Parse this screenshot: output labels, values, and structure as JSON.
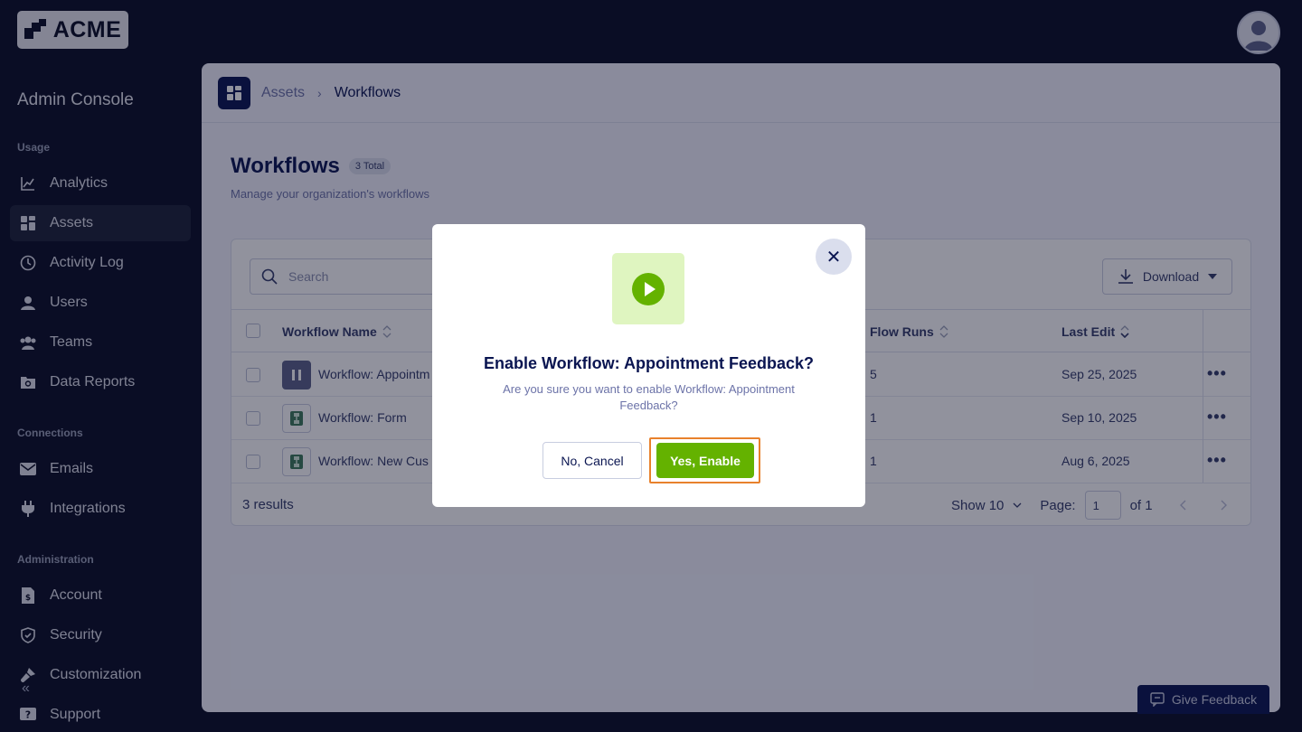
{
  "brand": {
    "logo_text": "ACME"
  },
  "sidebar": {
    "title": "Admin Console",
    "sections": {
      "usage": "Usage",
      "connections": "Connections",
      "administration": "Administration"
    },
    "items": [
      {
        "label": "Analytics",
        "icon": "chart-icon"
      },
      {
        "label": "Assets",
        "icon": "assets-icon",
        "active": true
      },
      {
        "label": "Activity Log",
        "icon": "clock-icon"
      },
      {
        "label": "Users",
        "icon": "user-icon"
      },
      {
        "label": "Teams",
        "icon": "team-icon"
      },
      {
        "label": "Data Reports",
        "icon": "report-icon"
      },
      {
        "label": "Emails",
        "icon": "mail-icon"
      },
      {
        "label": "Integrations",
        "icon": "plug-icon"
      },
      {
        "label": "Account",
        "icon": "account-icon"
      },
      {
        "label": "Security",
        "icon": "shield-icon"
      },
      {
        "label": "Customization",
        "icon": "brush-icon"
      },
      {
        "label": "Support",
        "icon": "help-icon"
      }
    ],
    "collapse_glyph": "«"
  },
  "breadcrumb": {
    "parent": "Assets",
    "separator": "›",
    "current": "Workflows"
  },
  "page": {
    "title": "Workflows",
    "count_badge": "3 Total",
    "subtitle": "Manage your organization's workflows"
  },
  "toolbar": {
    "search_placeholder": "Search",
    "download_label": "Download"
  },
  "table": {
    "headers": {
      "name": "Workflow Name",
      "runs": "Flow Runs",
      "edit": "Last Edit"
    },
    "rows": [
      {
        "name": "Workflow: Appointm",
        "runs": "5",
        "edit": "Sep 25, 2025",
        "status": "paused"
      },
      {
        "name": "Workflow: Form",
        "runs": "1",
        "edit": "Sep 10, 2025",
        "status": "active"
      },
      {
        "name": "Workflow: New Cus",
        "runs": "1",
        "edit": "Aug 6, 2025",
        "status": "active"
      }
    ],
    "actions_glyph": "•••"
  },
  "footer": {
    "results": "3 results",
    "show": "Show 10",
    "page_label": "Page:",
    "page_value": "1",
    "of": "of 1"
  },
  "modal": {
    "title": "Enable Workflow: Appointment Feedback?",
    "text": "Are you sure you want to enable Workflow: Appointment Feedback?",
    "cancel_label": "No, Cancel",
    "confirm_label": "Yes, Enable",
    "close_glyph": "✕",
    "accent_color": "#64b200"
  },
  "feedback": {
    "label": "Give Feedback"
  }
}
